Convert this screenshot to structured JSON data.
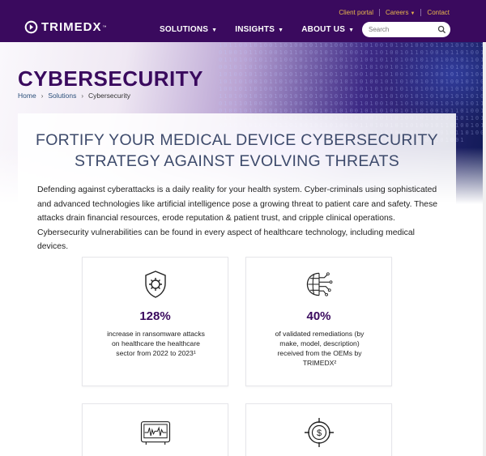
{
  "brand": {
    "name": "TRIMEDX",
    "tm": "™",
    "primary": "#3a0a5e",
    "accent": "#e9b74c"
  },
  "util_nav": [
    {
      "label": "Client portal",
      "dropdown": false
    },
    {
      "label": "Careers",
      "dropdown": true
    },
    {
      "label": "Contact",
      "dropdown": false
    }
  ],
  "main_nav": [
    {
      "label": "SOLUTIONS"
    },
    {
      "label": "INSIGHTS"
    },
    {
      "label": "ABOUT US"
    }
  ],
  "search": {
    "placeholder": "Search",
    "icon": "search-icon"
  },
  "hero": {
    "title": "CYBERSECURITY",
    "digits": "101100101001101001011010010110100101101001011010010110100101101001011010010110100101101001011010010110100101101001011010010110100101101001011010010110100101101001011010010110100101101001011010010110100101101001011010010110100101101001011010010110100101101001011010010110100101101001011010010110100101101001011010010110100101101001011010010110100101101001011010010110100101101001011010010110100101101001011010010110100101101001011010010110100101101001011010010110100101101001011010010110100101101001011010010110100101101001011010010110100101101001011010010110100101101001011010010110100101101001011010010110100101101001011010010110100101101001011010010110100101101001011010010110100101101001011010010110100101101001011010010110100101101001"
  },
  "breadcrumb": [
    {
      "label": "Home",
      "link": true
    },
    {
      "label": "Solutions",
      "link": true
    },
    {
      "label": "Cybersecurity",
      "link": false
    }
  ],
  "main": {
    "headline_line1": "FORTIFY YOUR MEDICAL DEVICE CYBERSECURITY",
    "headline_line2": "STRATEGY AGAINST EVOLVING THREATS",
    "intro": "Defending against cyberattacks is a daily reality for your health system. Cyber-criminals using sophisticated and advanced technologies like artificial intelligence pose a growing threat to patient care and safety. These attacks drain financial resources, erode reputation & patient trust, and cripple clinical operations. Cybersecurity vulnerabilities can be found in every aspect of healthcare technology, including medical devices."
  },
  "stats": [
    {
      "icon": "shield-gear-icon",
      "value": "128%",
      "desc": "increase in ransomware attacks on healthcare the healthcare sector from 2022 to 2023¹"
    },
    {
      "icon": "ai-brain-icon",
      "value": "40%",
      "desc": "of validated remediations (by make, model, description) received from the OEMs by TRIMEDX²"
    },
    {
      "icon": "monitor-icon",
      "value": "",
      "desc": ""
    },
    {
      "icon": "dollar-target-icon",
      "value": "",
      "desc": ""
    }
  ]
}
